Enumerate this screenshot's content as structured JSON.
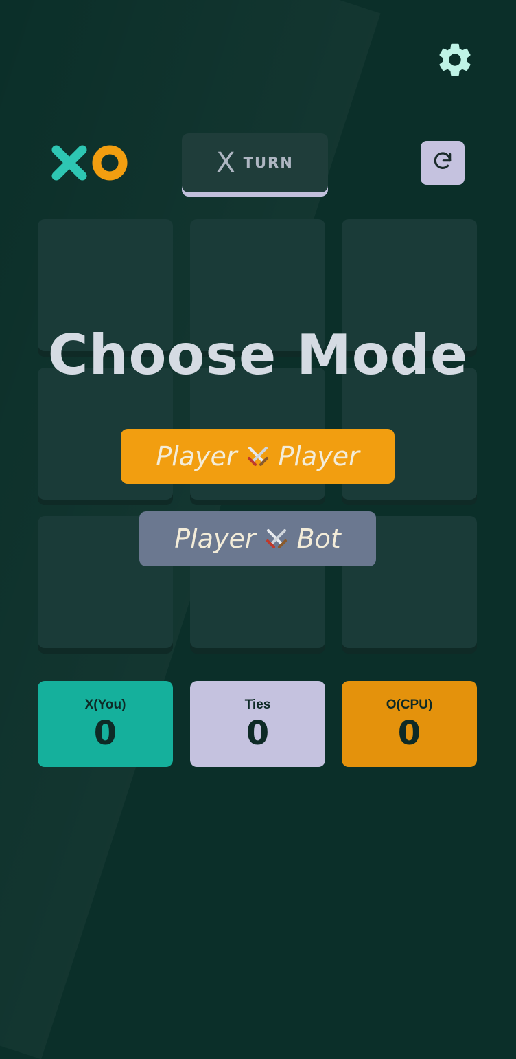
{
  "colors": {
    "background": "#0b2f29",
    "cell": "#1a3b38",
    "x_accent": "#2ec6b3",
    "o_accent": "#f29e10",
    "turn_underline": "#c2c0dc",
    "x_score_bg": "#15b09c",
    "ties_bg": "#c5c2df",
    "o_score_bg": "#e4920c",
    "pvb_button_bg": "#6b7890"
  },
  "icons": {
    "settings": "gear-icon",
    "restart": "restart-icon",
    "mode_separator": "crossed-swords-icon"
  },
  "header": {
    "logo_x": "X",
    "logo_o": "O",
    "turn": {
      "mark": "X",
      "label": "TURN"
    }
  },
  "board": {
    "cells": [
      "",
      "",
      "",
      "",
      "",
      "",
      "",
      "",
      ""
    ]
  },
  "modal": {
    "title": "Choose Mode",
    "buttons": [
      {
        "left": "Player",
        "right": "Player"
      },
      {
        "left": "Player",
        "right": "Bot"
      }
    ]
  },
  "scores": [
    {
      "label": "X(You)",
      "value": "0"
    },
    {
      "label": "Ties",
      "value": "0"
    },
    {
      "label": "O(CPU)",
      "value": "0"
    }
  ]
}
